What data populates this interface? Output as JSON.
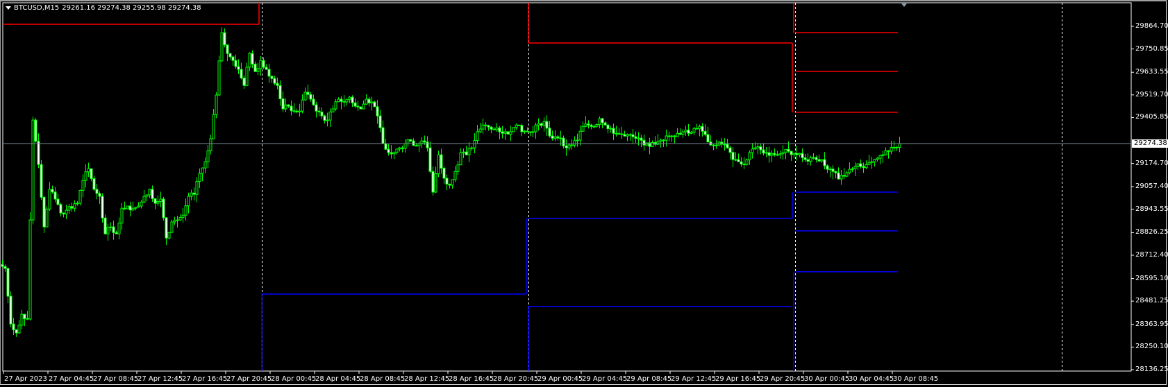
{
  "header": {
    "symbol": "BTCUSD,M15",
    "ohlc": "29261.16 29274.38 29255.98 29274.38"
  },
  "colors": {
    "background": "#000000",
    "candle": "#00ff00",
    "resistance": "#ff0000",
    "support": "#0000ff",
    "grid": "#ffffff",
    "bid_line": "#778899"
  },
  "chart_data": {
    "type": "candlestick",
    "title": "BTCUSD,M15",
    "timeframe": "M15",
    "ylim": [
      28136.25,
      29978
    ],
    "price_ticks": [
      "29864.70",
      "29750.85",
      "29633.55",
      "29519.70",
      "29405.85",
      "29174.70",
      "29057.40",
      "28943.55",
      "28826.25",
      "28712.40",
      "28595.10",
      "28481.25",
      "28363.95",
      "28250.10",
      "28136.25"
    ],
    "price_tick_values": [
      29864.7,
      29750.85,
      29633.55,
      29519.7,
      29405.85,
      29174.7,
      29057.4,
      28943.55,
      28826.25,
      28712.4,
      28595.1,
      28481.25,
      28363.95,
      28250.1,
      28136.25
    ],
    "time_ticks": [
      "27 Apr 2023",
      "27 Apr 04:45",
      "27 Apr 08:45",
      "27 Apr 12:45",
      "27 Apr 16:45",
      "27 Apr 20:45",
      "28 Apr 00:45",
      "28 Apr 04:45",
      "28 Apr 08:45",
      "28 Apr 12:45",
      "28 Apr 16:45",
      "28 Apr 20:45",
      "29 Apr 00:45",
      "29 Apr 04:45",
      "29 Apr 08:45",
      "29 Apr 12:45",
      "29 Apr 16:45",
      "29 Apr 20:45",
      "30 Apr 00:45",
      "30 Apr 04:45",
      "30 Apr 08:45"
    ],
    "current_price": "29274.38",
    "current_price_value": 29274.38,
    "closes_every_30min": [
      28646,
      28366,
      28321,
      28415,
      28391,
      29393,
      29169,
      28855,
      29044,
      28995,
      28925,
      28939,
      28949,
      28974,
      29089,
      29148,
      29044,
      29009,
      28820,
      28855,
      28820,
      28949,
      28960,
      28949,
      28960,
      29009,
      29044,
      28974,
      28995,
      28799,
      28880,
      28890,
      28914,
      29009,
      29019,
      29124,
      29183,
      29299,
      29519,
      29833,
      29728,
      29693,
      29648,
      29567,
      29728,
      29637,
      29693,
      29648,
      29602,
      29567,
      29449,
      29463,
      29438,
      29438,
      29533,
      29498,
      29438,
      29414,
      29393,
      29449,
      29498,
      29484,
      29508,
      29463,
      29449,
      29498,
      29484,
      29414,
      29274,
      29229,
      29229,
      29253,
      29274,
      29288,
      29264,
      29288,
      29253,
      29030,
      29218,
      29100,
      29065,
      29134,
      29229,
      29218,
      29253,
      29334,
      29368,
      29358,
      29344,
      29334,
      29334,
      29334,
      29368,
      29334,
      29334,
      29334,
      29375,
      29386,
      29313,
      29309,
      29302,
      29253,
      29267,
      29292,
      29361,
      29368,
      29361,
      29400,
      29368,
      29351,
      29326,
      29320,
      29320,
      29309,
      29302,
      29267,
      29260,
      29271,
      29292,
      29313,
      29313,
      29326,
      29334,
      29326,
      29351,
      29361,
      29320,
      29267,
      29267,
      29271,
      29253,
      29194,
      29183,
      29169,
      29229,
      29253,
      29243,
      29229,
      29225,
      29218,
      29229,
      29236,
      29225,
      29225,
      29194,
      29204,
      29194,
      29194,
      29145,
      29134,
      29096,
      29110,
      29145,
      29159,
      29159,
      29169,
      29183,
      29201,
      29218,
      29236,
      29253,
      29274
    ],
    "indicator_levels": {
      "day1": {
        "resistance": [
          29875
        ],
        "support": []
      },
      "day2": {
        "resistance": [],
        "support": [
          28517
        ]
      },
      "day3": {
        "resistance": [
          29781
        ],
        "support": [
          28898,
          28455
        ]
      },
      "day4": {
        "resistance": [
          29833,
          29638,
          29432
        ],
        "support": [
          29030,
          28835,
          28629
        ]
      }
    }
  }
}
